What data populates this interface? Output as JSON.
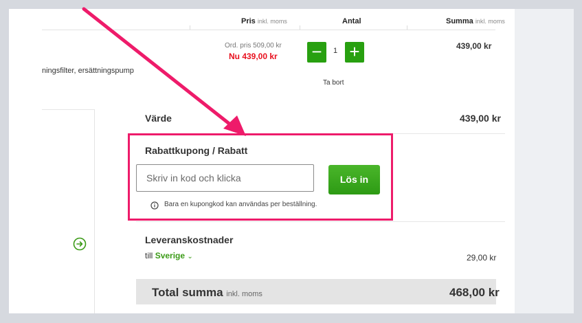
{
  "table_header": {
    "price_label": "Pris",
    "price_suffix": "inkl. moms",
    "qty_label": "Antal",
    "sum_label": "Summa",
    "sum_suffix": "inkl. moms"
  },
  "cart_item": {
    "name_fragment": "ningsfilter, ersättningspump",
    "orig_price": "Ord. pris 509,00 kr",
    "now_price": "Nu 439,00 kr",
    "minus": "−",
    "quantity": "1",
    "plus": "+",
    "remove_label": "Ta bort",
    "line_total": "439,00 kr"
  },
  "summary": {
    "value_label": "Värde",
    "value_amount": "439,00 kr"
  },
  "coupon": {
    "title": "Rabattkupong / Rabatt",
    "placeholder": "Skriv in kod och klicka",
    "redeem_label": "Lös in",
    "info_icon": "info-icon",
    "note": "Bara en kupongkod kan användas per beställning."
  },
  "shipping": {
    "title": "Leveranskostnader",
    "to_prefix": "till",
    "country": "Sverige",
    "amount": "29,00 kr",
    "arrow_icon": "arrow-right-circle-icon"
  },
  "total": {
    "label": "Total summa",
    "suffix": "inkl. moms",
    "amount": "468,00 kr"
  },
  "colors": {
    "accent_green": "#2d9a14",
    "price_red": "#e8101e",
    "highlight_pink": "#ee1b6a",
    "country_green": "#3a9a16"
  }
}
